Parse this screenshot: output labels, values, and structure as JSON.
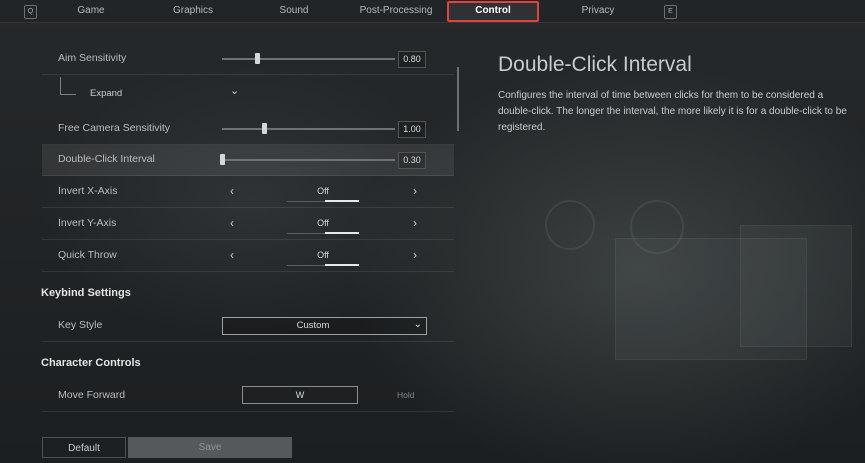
{
  "tabs": {
    "left_key": "Q",
    "right_key": "E",
    "items": [
      "Game",
      "Graphics",
      "Sound",
      "Post-Processing",
      "Control",
      "Privacy"
    ],
    "active": "Control"
  },
  "settings": {
    "aim_sensitivity": {
      "label": "Aim Sensitivity",
      "value": "0.80",
      "fraction": 0.2
    },
    "expand": {
      "label": "Expand"
    },
    "free_camera_sensitivity": {
      "label": "Free Camera Sensitivity",
      "value": "1.00",
      "fraction": 0.24
    },
    "double_click_interval": {
      "label": "Double-Click Interval",
      "value": "0.30",
      "fraction": 0.0
    },
    "invert_x": {
      "label": "Invert X-Axis",
      "value": "Off"
    },
    "invert_y": {
      "label": "Invert Y-Axis",
      "value": "Off"
    },
    "quick_throw": {
      "label": "Quick Throw",
      "value": "Off"
    }
  },
  "keybind_settings": {
    "title": "Keybind Settings",
    "key_style": {
      "label": "Key Style",
      "value": "Custom"
    }
  },
  "character_controls": {
    "title": "Character Controls",
    "move_forward": {
      "label": "Move Forward",
      "key": "W",
      "mode": "Hold"
    }
  },
  "detail": {
    "title": "Double-Click Interval",
    "description": "Configures the interval of time between clicks for them to be considered a double-click. The longer the interval, the more likely it is for a double-click to be registered."
  },
  "buttons": {
    "default": "Default",
    "save": "Save"
  },
  "colors": {
    "highlight": "#e0433f",
    "background": "#1f2224"
  }
}
